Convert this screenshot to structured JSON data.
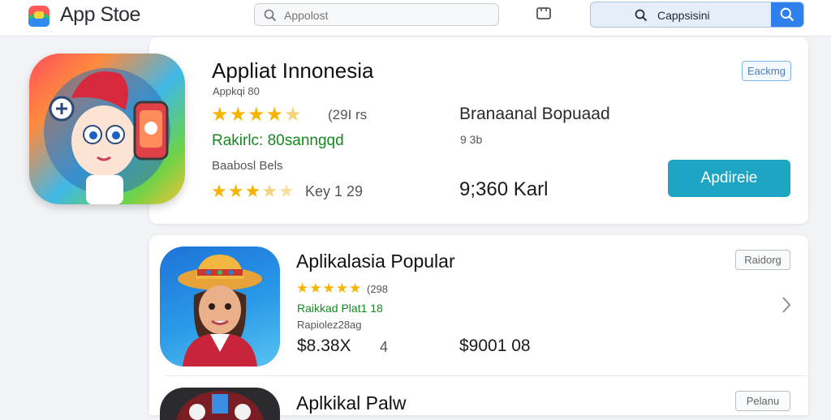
{
  "header": {
    "brand": "App Stoe",
    "search_placeholder": "Appolost",
    "search_query": "Cappsisini"
  },
  "featured": {
    "title": "Appliat Innonesia",
    "subtitle": "Appkqi 80",
    "rating_count": "(29I rs",
    "rank_text": "Rakirlc: 80sanngqd",
    "section_label": "Baabosl Bels",
    "sub_rating_text": "Key   1   29",
    "right_title": "Branaanal Bopuaad",
    "right_meta": "9 3b",
    "right_price": "9;360 Karl",
    "tag_button": "Eackmg",
    "get_button": "Apdireie",
    "rating_value": 4.5,
    "sub_rating_value": 3.5
  },
  "list": [
    {
      "title": "Aplikalasia Popular",
      "rating_count": "(298",
      "rank_text": "Raikkad Plat1 18",
      "meta": "Rapiolez28ag",
      "price_left": "$8.38X",
      "count": "4",
      "price_right": "$9001 08",
      "tag_button": "Raidorg",
      "rating_value": 5
    },
    {
      "title": "Aplkikal Palw",
      "tag_button": "Pelanu"
    }
  ],
  "colors": {
    "accent": "#2f80ed",
    "get_button": "#1fa5c4",
    "star": "#f5b400",
    "rank_green": "#15891f"
  }
}
